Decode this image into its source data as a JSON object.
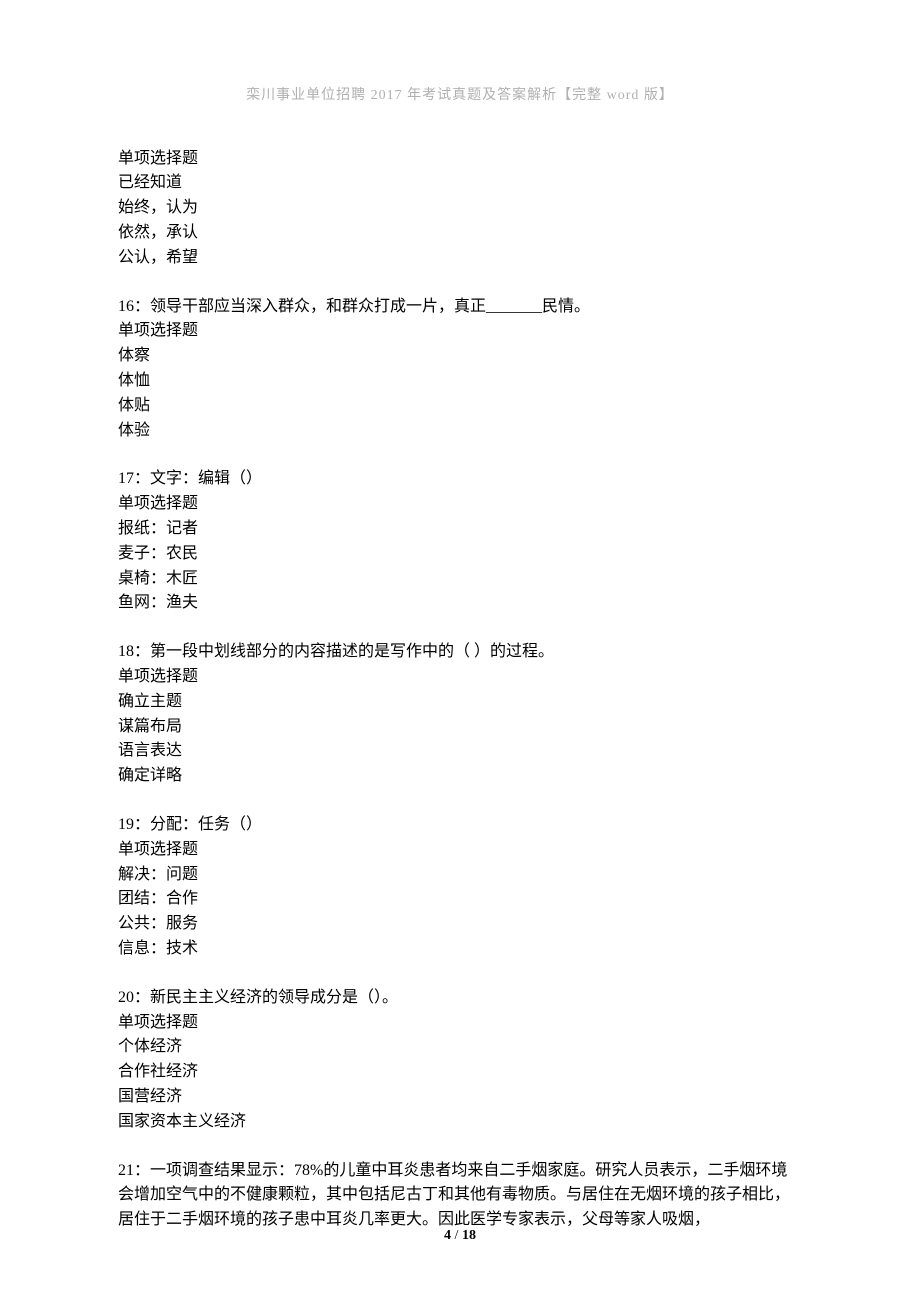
{
  "header": "栾川事业单位招聘 2017 年考试真题及答案解析【完整 word 版】",
  "blocks": [
    {
      "lines": [
        "单项选择题",
        "已经知道",
        "始终，认为",
        "依然，承认",
        "公认，希望"
      ]
    },
    {
      "lines": [
        "16：领导干部应当深入群众，和群众打成一片，真正_______民情。",
        "单项选择题",
        "体察",
        "体恤",
        "体贴",
        "体验"
      ]
    },
    {
      "lines": [
        "17：文字：编辑（）",
        "单项选择题",
        "报纸：记者",
        "麦子：农民",
        "桌椅：木匠",
        "鱼网：渔夫"
      ]
    },
    {
      "lines": [
        "18：第一段中划线部分的内容描述的是写作中的（ ）的过程。",
        "单项选择题",
        "确立主题",
        "谋篇布局",
        "语言表达",
        "确定详略"
      ]
    },
    {
      "lines": [
        "19：分配：任务（）",
        "单项选择题",
        "解决：问题",
        "团结：合作",
        "公共：服务",
        "信息：技术"
      ]
    },
    {
      "lines": [
        "20：新民主主义经济的领导成分是（）。",
        "单项选择题",
        "个体经济",
        "合作社经济",
        "国营经济",
        "国家资本主义经济"
      ]
    },
    {
      "lines": [
        "21：一项调查结果显示：78%的儿童中耳炎患者均来自二手烟家庭。研究人员表示，二手烟环境会增加空气中的不健康颗粒，其中包括尼古丁和其他有毒物质。与居住在无烟环境的孩子相比，居住于二手烟环境的孩子患中耳炎几率更大。因此医学专家表示，父母等家人吸烟，"
      ]
    }
  ],
  "footer": {
    "current": "4",
    "sep": " / ",
    "total": "18"
  }
}
